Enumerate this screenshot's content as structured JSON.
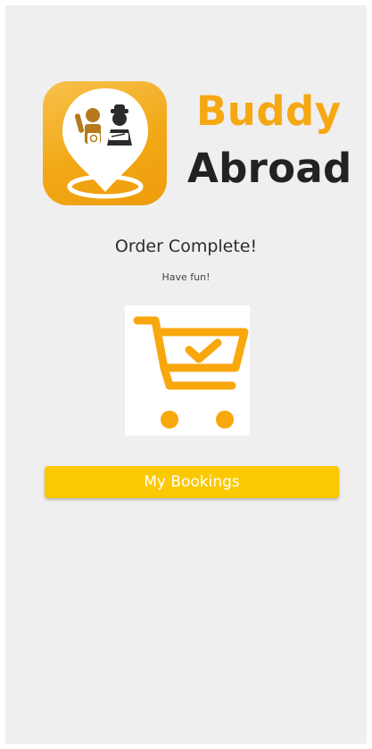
{
  "brand": {
    "line1": "Buddy",
    "line2": "Abroad",
    "icon": "map-pin-travelers-icon"
  },
  "order": {
    "title": "Order Complete!",
    "subtitle": "Have fun!",
    "icon": "shopping-cart-check-icon"
  },
  "actions": {
    "bookings_label": "My Bookings"
  },
  "colors": {
    "accent": "#f5a812",
    "button": "#fbc902",
    "text_dark": "#222222",
    "background": "#efefef"
  }
}
